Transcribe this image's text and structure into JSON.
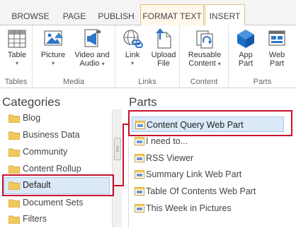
{
  "tabs": [
    {
      "label": "BROWSE"
    },
    {
      "label": "PAGE"
    },
    {
      "label": "PUBLISH"
    },
    {
      "label": "FORMAT TEXT"
    },
    {
      "label": "INSERT"
    }
  ],
  "ribbon": {
    "tables": {
      "group_label": "Tables",
      "table_label": "Table"
    },
    "media": {
      "group_label": "Media",
      "picture_label": "Picture",
      "video_label_1": "Video and",
      "video_label_2": "Audio"
    },
    "links": {
      "group_label": "Links",
      "link_label": "Link",
      "upload_label_1": "Upload",
      "upload_label_2": "File"
    },
    "content": {
      "group_label": "Content",
      "reusable_label_1": "Reusable",
      "reusable_label_2": "Content"
    },
    "parts": {
      "group_label": "Parts",
      "app_label_1": "App",
      "app_label_2": "Part",
      "web_label_1": "Web",
      "web_label_2": "Part"
    }
  },
  "categories": {
    "title": "Categories",
    "items": [
      "Blog",
      "Business Data",
      "Community",
      "Content Rollup",
      "Default",
      "Document Sets",
      "Filters"
    ],
    "selected": "Default"
  },
  "parts": {
    "title": "Parts",
    "items": [
      "Content Query Web Part",
      "I need to...",
      "RSS Viewer",
      "Summary Link Web Part",
      "Table Of Contents Web Part",
      "This Week in Pictures"
    ],
    "selected": "Content Query Web Part"
  },
  "colors": {
    "accent_blue": "#2f75c8",
    "highlight_red": "#c8102e",
    "selection_bg": "#dbe9f8",
    "folder_yellow": "#f2c95a"
  }
}
